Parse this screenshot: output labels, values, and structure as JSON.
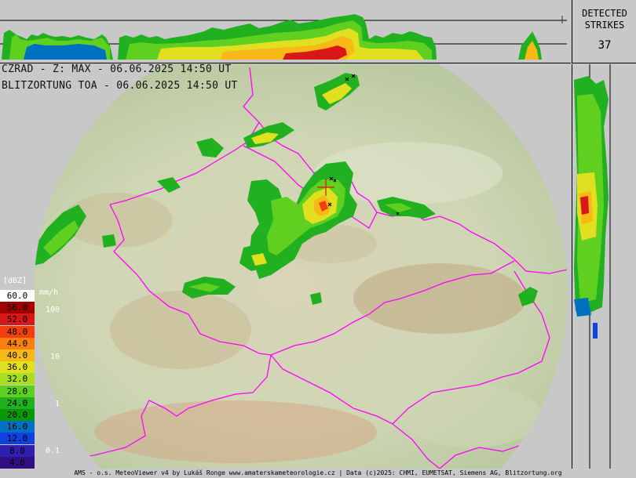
{
  "header": {
    "line1": "CZRAD - Z: MAX - 06.06.2025 14:50 UT",
    "line2": "BLITZORTUNG TOA - 06.06.2025 14:50 UT"
  },
  "strikes": {
    "label_line1": "DETECTED",
    "label_line2": "STRIKES",
    "count": "37"
  },
  "legend": {
    "unit_dbz": "[dBZ]",
    "unit_mmh": "mm/h",
    "levels": [
      {
        "dbz": "60.0",
        "color": "#ffffff",
        "text_color": "#000"
      },
      {
        "dbz": "56.0",
        "color": "#a00000",
        "text_color": "#000"
      },
      {
        "dbz": "52.0",
        "color": "#d81818",
        "text_color": "#000"
      },
      {
        "dbz": "48.0",
        "color": "#f04010",
        "text_color": "#000"
      },
      {
        "dbz": "44.0",
        "color": "#f88010",
        "text_color": "#000"
      },
      {
        "dbz": "40.0",
        "color": "#f8b818",
        "text_color": "#000"
      },
      {
        "dbz": "36.0",
        "color": "#e0e020",
        "text_color": "#000"
      },
      {
        "dbz": "32.0",
        "color": "#a8e020",
        "text_color": "#000"
      },
      {
        "dbz": "28.0",
        "color": "#60d020",
        "text_color": "#000"
      },
      {
        "dbz": "24.0",
        "color": "#20b020",
        "text_color": "#000"
      },
      {
        "dbz": "20.0",
        "color": "#089808",
        "text_color": "#000"
      },
      {
        "dbz": "16.0",
        "color": "#0070c0",
        "text_color": "#000"
      },
      {
        "dbz": "12.0",
        "color": "#1040e0",
        "text_color": "#000"
      },
      {
        "dbz": "8.0",
        "color": "#3020b0",
        "text_color": "#000"
      },
      {
        "dbz": "4.0",
        "color": "#301080",
        "text_color": "#000"
      }
    ],
    "mmh_marks": [
      "100",
      "10",
      "1",
      "0.1"
    ]
  },
  "footer": {
    "text": "AMS - o.s. MeteoViewer v4 by Lukáš Ronge www.amaterskameteorologie.cz | Data (c)2025: CHMI, EUMETSAT, Siemens AG, Blitzortung.org"
  },
  "colors": {
    "border_line": "#ff00ff",
    "disk_fill": "#d8d8c8",
    "background": "#c8c8c8"
  }
}
